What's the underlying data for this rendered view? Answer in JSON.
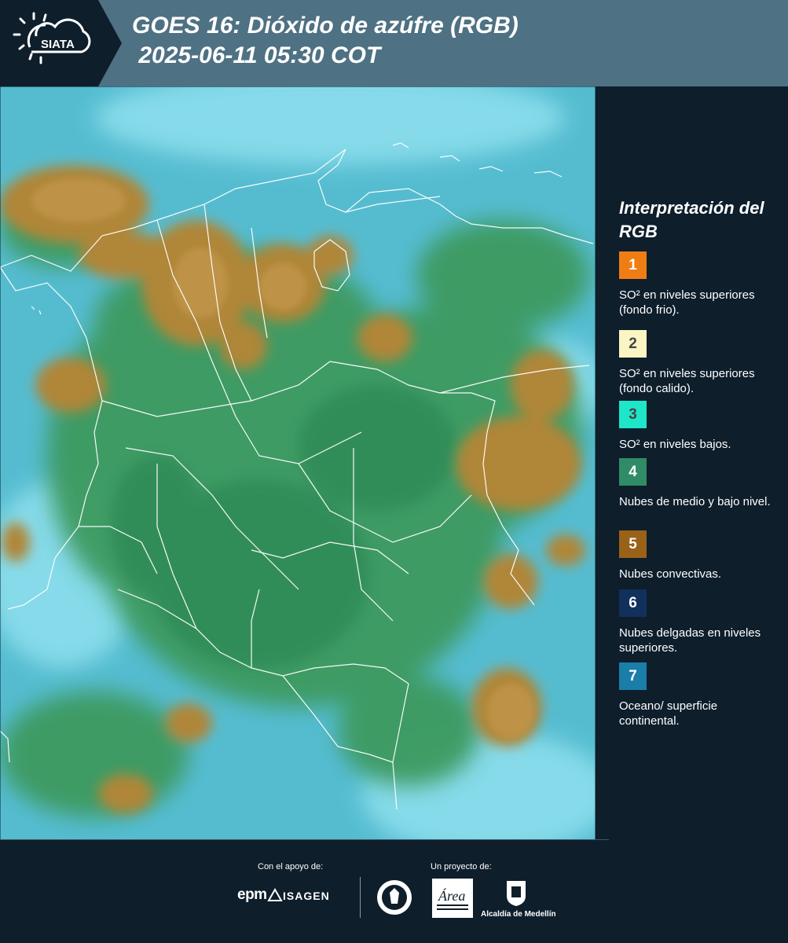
{
  "header": {
    "brand": "SIATA",
    "title_line1": "GOES 16: Dióxido de azúfre (RGB)",
    "title_line2": " 2025-06-11 05:30 COT",
    "bg_color": "#4e7183",
    "logo_bg_color": "#0e1e2b"
  },
  "map": {
    "description_icon": "satellite-rgb-map",
    "boundary_color": "#ffffff",
    "colors": {
      "ocean_surface": "#4fb6c9",
      "mid_low_clouds": "#3a8f55",
      "convective": "#b38a3a"
    }
  },
  "legend": {
    "title": "Interpretación del RGB",
    "items": [
      {
        "number": "1",
        "color": "#f07d14",
        "label": "SO² en niveles superiores (fondo frio)."
      },
      {
        "number": "2",
        "color": "#fbf4c3",
        "label": "SO² en niveles superiores (fondo calido)."
      },
      {
        "number": "3",
        "color": "#1ee6c8",
        "label": "SO² en niveles bajos."
      },
      {
        "number": "4",
        "color": "#2f8c66",
        "label": "Nubes de medio y bajo nivel."
      },
      {
        "number": "5",
        "color": "#9a6118",
        "label": "Nubes convectivas."
      },
      {
        "number": "6",
        "color": "#11305c",
        "label": "Nubes delgadas en niveles superiores."
      },
      {
        "number": "7",
        "color": "#1a7ea8",
        "label": "Oceano/ superficie continental."
      }
    ]
  },
  "footer": {
    "support_label": "Con el apoyo de:",
    "project_label": "Un proyecto de:",
    "sponsors": [
      "epm",
      "ISAGEN"
    ],
    "partners": [
      "Área Metropolitana Valle de Aburrá",
      "Alcaldía de Medellín"
    ],
    "alcaldia_label": "Alcaldía de Medellín"
  }
}
